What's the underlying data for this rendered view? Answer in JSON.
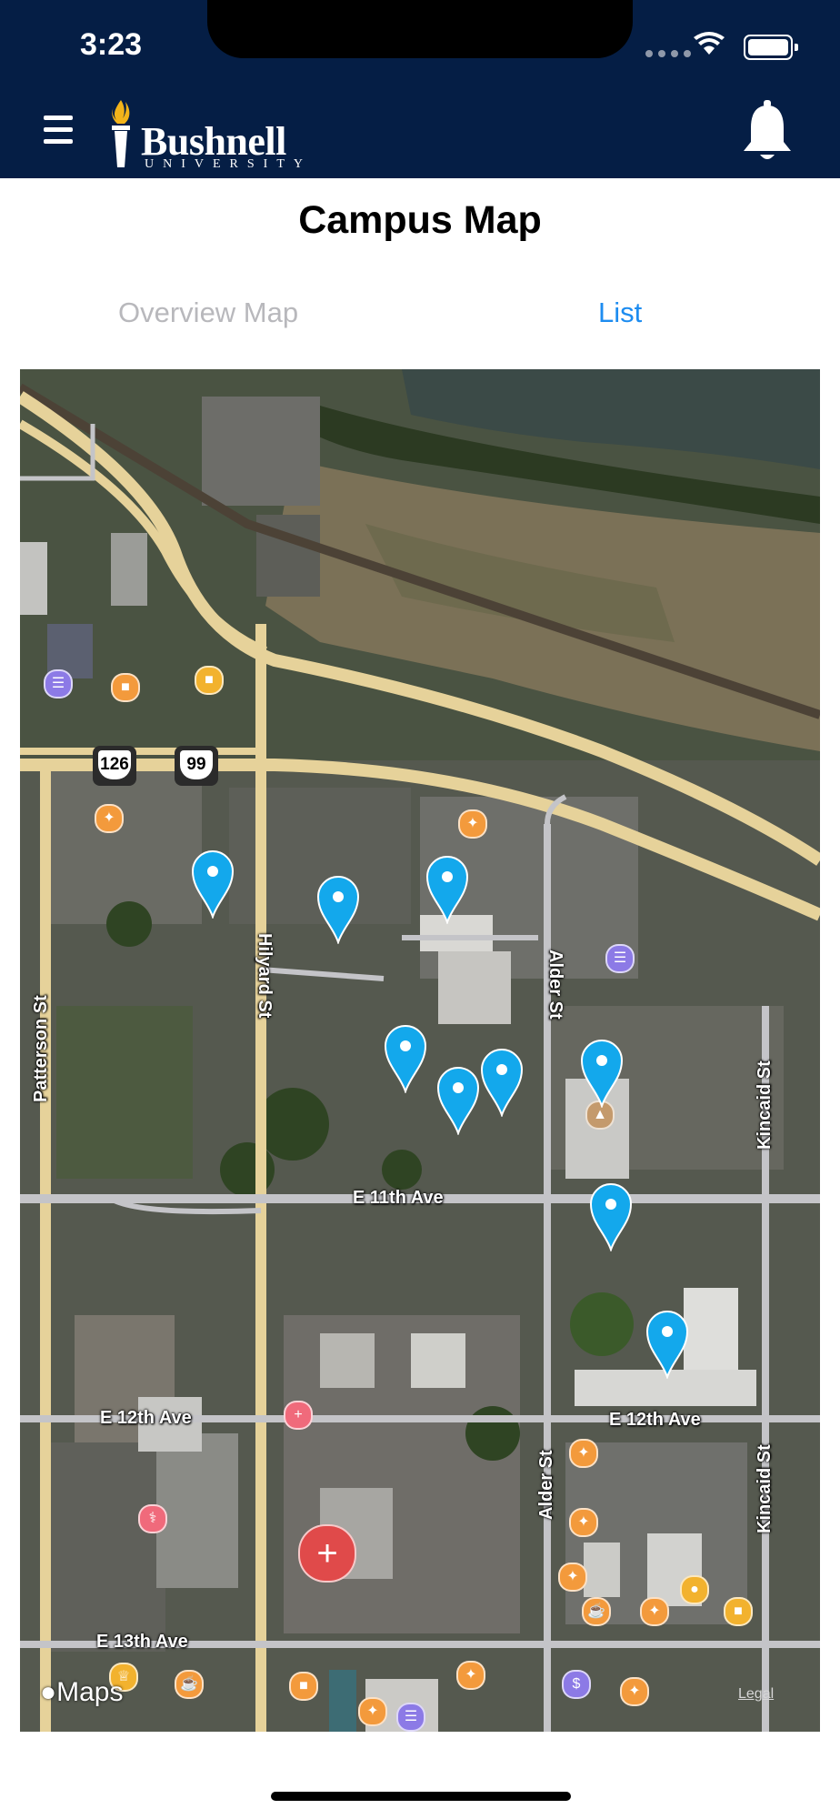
{
  "status_bar": {
    "time": "3:23"
  },
  "header": {
    "logo_name": "Bushnell",
    "logo_sub": "UNIVERSITY",
    "menu_icon": "hamburger-menu-icon",
    "bell_icon": "bell-icon",
    "brand_color": "#051e45"
  },
  "page": {
    "title": "Campus Map"
  },
  "tabs": [
    {
      "label": "Overview Map",
      "selected": false
    },
    {
      "label": "List",
      "selected": true
    }
  ],
  "map": {
    "attribution": "Maps",
    "legal": "Legal",
    "pin_color": "#13a8ec",
    "road_labels": {
      "patterson": "Patterson St",
      "hilyard": "Hilyard St",
      "alder_upper": "Alder St",
      "alder_lower": "Alder St",
      "kincaid_upper": "Kincaid St",
      "kincaid_lower": "Kincaid St",
      "e11th": "E 11th Ave",
      "e12th_left": "E 12th Ave",
      "e12th_right": "E 12th Ave",
      "e13th": "E 13th Ave"
    },
    "route_shields": [
      "126",
      "99"
    ],
    "pin_count": 9
  }
}
